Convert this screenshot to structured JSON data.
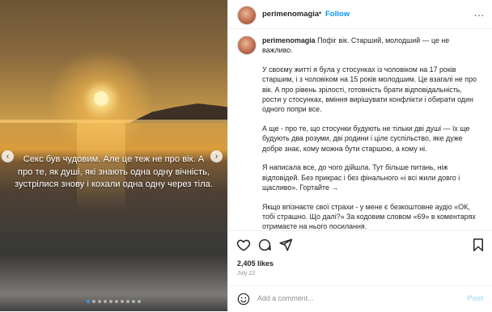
{
  "media": {
    "overlay_text": "Секс був чудовим. Але це теж не про вік. А про те, як душі, які знають одна одну вічність, зустрілися знову і кохали одна одну через тіла.",
    "carousel_count": 10,
    "carousel_active_index": 0,
    "prev_arrow": "‹",
    "next_arrow": "›"
  },
  "header": {
    "username": "perimenomagia",
    "separator": "•",
    "follow_label": "Follow",
    "more_label": "..."
  },
  "caption": {
    "username": "perimenomagia",
    "paragraphs": [
      "Пофіг вік. Старший, молодший — це не важливо.",
      "У своєму житті я була у стосунках із чоловіком на 17 років старшим, і з чоловіком на 15 років молодшим. Це взагалі не про вік. А про рівень зрілості, готовність брати відповідальність, рости у стосунках, вміння вирішувати конфлікти і обирати один одного попри все.",
      "А ще - про те, що стосунки будують не тільки дві душі — їх ще будують два розуми, дві родини і ціле суспільство, яке дуже добре знає, кому можна бути старшою, а кому ні.",
      "Я написала все, до чого дійшла. Тут більше питань, ніж відповідей. Без прикрас і без фінального «і всі жили довго і щасливо». Гортайте →",
      "Якщо впізнаєте свої страхи - у мене є безкоштовне аудіо «ОК, тобі страшно. Що далі?» За кодовим словом «69» в коментарях отримаєте на нього посилання."
    ]
  },
  "stats": {
    "likes": "2,405 likes",
    "date": "July 22"
  },
  "comment": {
    "placeholder": "Add a comment...",
    "post_label": "Post"
  },
  "colors": {
    "follow": "#0095f6",
    "post_disabled": "#b2dffc",
    "muted": "#8e8e8e",
    "text": "#262626"
  },
  "icons": [
    "heart-icon",
    "comment-icon",
    "share-icon",
    "bookmark-icon",
    "emoji-icon"
  ]
}
